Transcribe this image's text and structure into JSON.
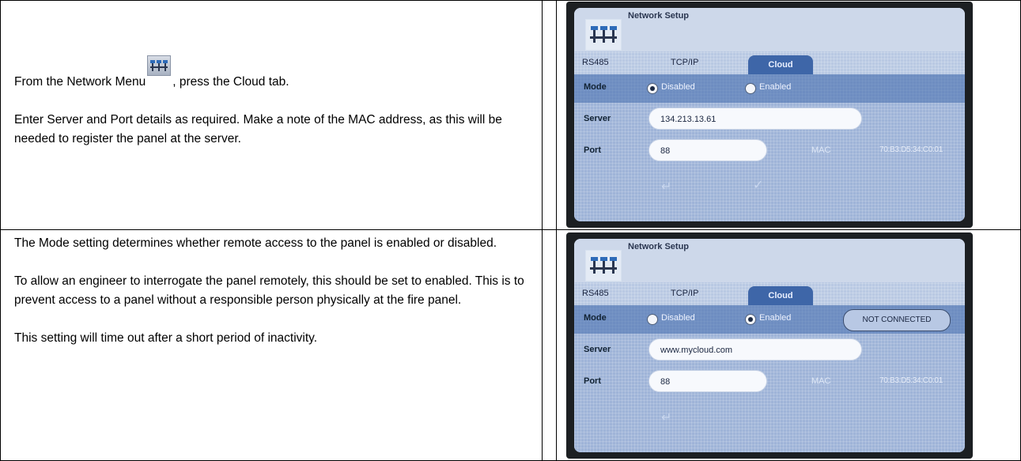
{
  "rows": [
    {
      "para1_before_icon": "From the Network Menu",
      "para1_after_icon": ", press the Cloud tab.",
      "para2": "Enter Server and Port details as required. Make a note of the MAC address, as this will be needed to register the panel at the server.",
      "screen": {
        "title": "Network Setup",
        "tabs": [
          "RS485",
          "TCP/IP",
          "Cloud"
        ],
        "mode_label": "Mode",
        "option_disabled": "Disabled",
        "option_enabled": "Enabled",
        "mode_selected": "Disabled",
        "server_label": "Server",
        "server_value": "134.213.13.61",
        "port_label": "Port",
        "port_value": "88",
        "mac_label": "MAC",
        "mac_value": "70:B3:D5:34:C0:01",
        "footer_icons": [
          "back-icon",
          "check-icon"
        ]
      }
    },
    {
      "para1": "The Mode setting determines whether remote access to the panel is enabled or disabled.",
      "para2": "To allow an engineer to interrogate the panel remotely, this should be set to enabled. This is to prevent access to a panel without a responsible person physically at the fire panel.",
      "para3": "This setting will time out after a short period of inactivity.",
      "screen": {
        "title": "Network Setup",
        "tabs": [
          "RS485",
          "TCP/IP",
          "Cloud"
        ],
        "mode_label": "Mode",
        "option_disabled": "Disabled",
        "option_enabled": "Enabled",
        "mode_selected": "Enabled",
        "status": "NOT CONNECTED",
        "server_label": "Server",
        "server_value": "www.mycloud.com",
        "port_label": "Port",
        "port_value": "88",
        "mac_label": "MAC",
        "mac_value": "70:B3:D5:34:C0:01",
        "footer_icons": [
          "back-icon"
        ]
      }
    }
  ],
  "colors": {
    "screen_bg": "#b9c9e3",
    "active_tab": "#3e66a8",
    "band": "#466eaf",
    "bezel": "#1c1f22"
  }
}
